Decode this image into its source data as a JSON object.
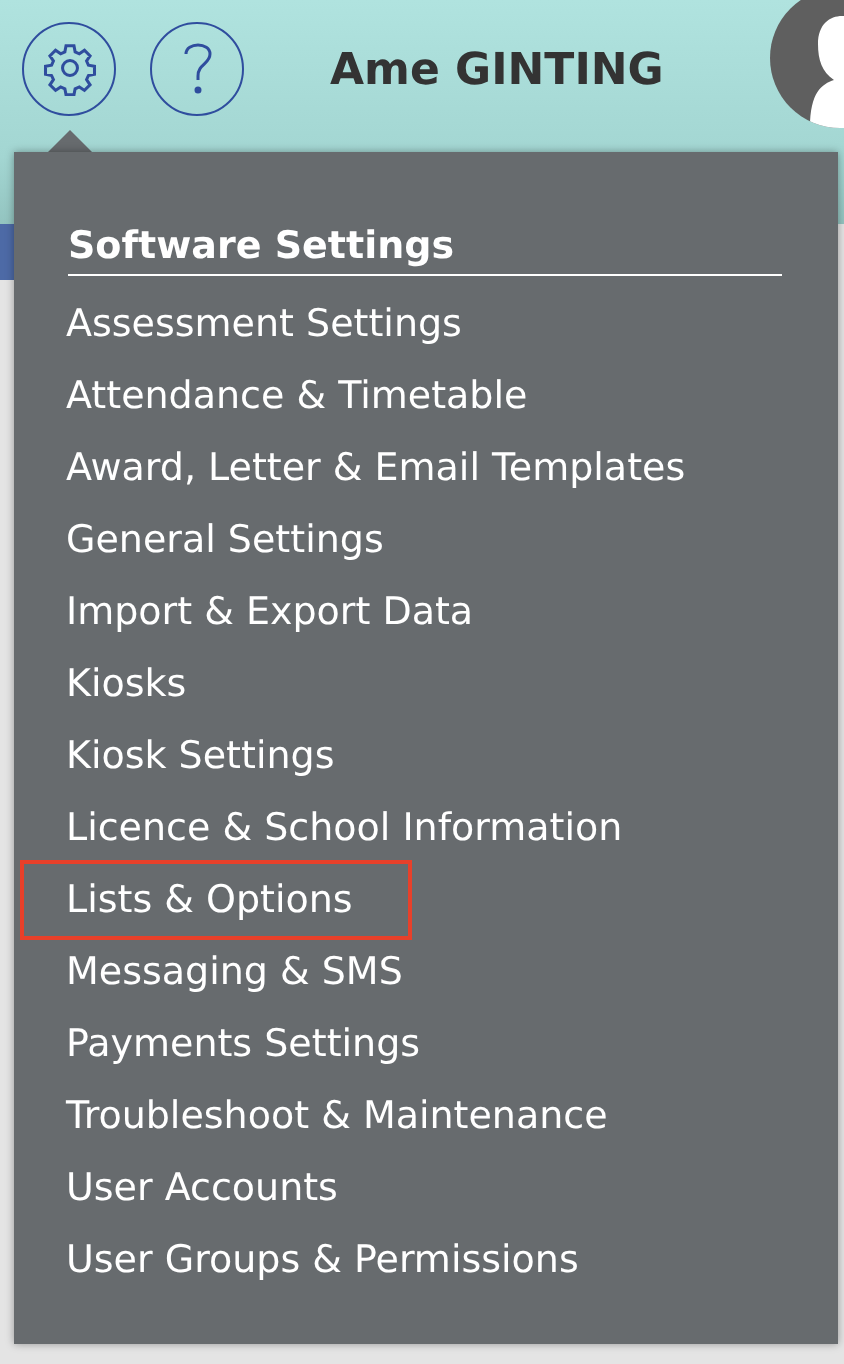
{
  "header": {
    "user_name": "Ame GINTING"
  },
  "settings_menu": {
    "heading": "Software Settings",
    "items": [
      {
        "label": "Assessment Settings",
        "selected": false
      },
      {
        "label": "Attendance & Timetable",
        "selected": false
      },
      {
        "label": "Award, Letter & Email Templates",
        "selected": false
      },
      {
        "label": "General Settings",
        "selected": false
      },
      {
        "label": "Import & Export Data",
        "selected": false
      },
      {
        "label": "Kiosks",
        "selected": false
      },
      {
        "label": "Kiosk Settings",
        "selected": false
      },
      {
        "label": "Licence & School Information",
        "selected": false
      },
      {
        "label": "Lists & Options",
        "selected": true
      },
      {
        "label": "Messaging & SMS",
        "selected": false
      },
      {
        "label": "Payments Settings",
        "selected": false
      },
      {
        "label": "Troubleshoot & Maintenance",
        "selected": false
      },
      {
        "label": "User Accounts",
        "selected": false
      },
      {
        "label": "User Groups & Permissions",
        "selected": false
      }
    ]
  }
}
